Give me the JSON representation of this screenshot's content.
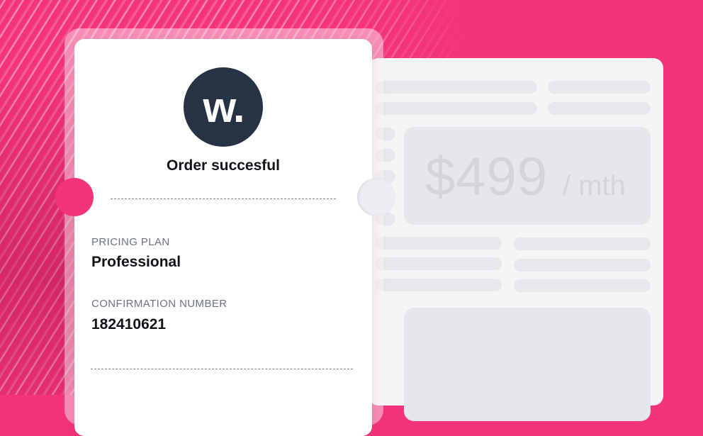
{
  "colors": {
    "background": "#f4347a",
    "logo_bg": "#253345",
    "ticket_bg": "#ffffff",
    "placeholder": "#e6e7ea"
  },
  "logo": {
    "text": "w.",
    "icon": "brand-logo-icon"
  },
  "ticket": {
    "title": "Order succesful",
    "plan_label": "PRICING PLAN",
    "plan_value": "Professional",
    "confirmation_label": "CONFIRMATION NUMBER",
    "confirmation_value": "182410621"
  },
  "pricing_card": {
    "price": "$499",
    "period": "/ mth"
  }
}
